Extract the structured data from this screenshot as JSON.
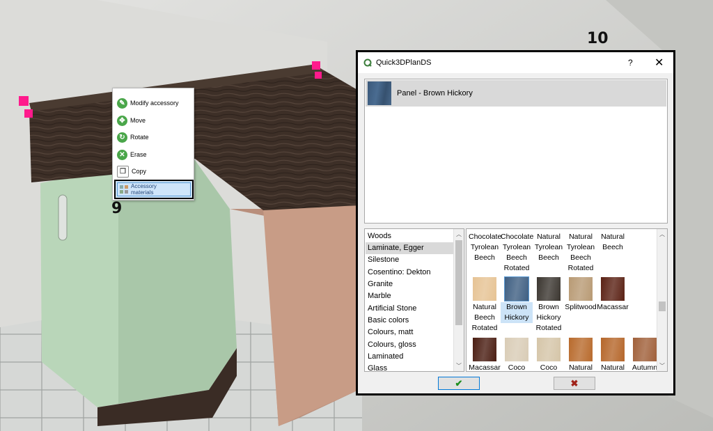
{
  "markers": {
    "step9": "9",
    "step10": "10"
  },
  "context_menu": {
    "items": [
      {
        "label": "Modify accessory",
        "icon": "wrench-icon",
        "color": "#4aa64a"
      },
      {
        "label": "Move",
        "icon": "move-icon",
        "color": "#4aa64a"
      },
      {
        "label": "Rotate",
        "icon": "rotate-icon",
        "color": "#4aa64a"
      },
      {
        "label": "Erase",
        "icon": "trash-icon",
        "color": "#4aa64a"
      },
      {
        "label": "Copy",
        "icon": "copy-icon",
        "color": "#666666"
      }
    ],
    "selected": {
      "line1": "Accessory",
      "line2": "materials",
      "icon": "materials-icon"
    }
  },
  "dialog": {
    "title": "Quick3DPlanDS",
    "help_label": "?",
    "close_label": "✕",
    "current_material": {
      "label": "Panel - Brown Hickory",
      "color": "#3f5f82"
    },
    "categories": [
      "Woods",
      "Laminate, Egger",
      "Silestone",
      "Cosentino: Dekton",
      "Granite",
      "Marble",
      "Artificial Stone",
      "Basic colors",
      "Colours, matt",
      "Colours, gloss",
      "Laminated",
      "Glass"
    ],
    "selected_category": "Laminate, Egger",
    "materials_row1": [
      {
        "lines": [
          "Chocolate",
          "Tyrolean",
          "Beech"
        ]
      },
      {
        "lines": [
          "Chocolate",
          "Tyrolean",
          "Beech",
          "Rotated"
        ]
      },
      {
        "lines": [
          "Natural",
          "Tyrolean",
          "Beech"
        ]
      },
      {
        "lines": [
          "Natural",
          "Tyrolean",
          "Beech",
          "Rotated"
        ]
      },
      {
        "lines": [
          "Natural",
          "Beech"
        ]
      }
    ],
    "materials_row2": [
      {
        "lines": [
          "Natural",
          "Beech",
          "Rotated"
        ],
        "color": "#e6c394"
      },
      {
        "lines": [
          "Brown",
          "Hickory"
        ],
        "color": "#3f5f82",
        "selected": true
      },
      {
        "lines": [
          "Brown",
          "Hickory",
          "Rotated"
        ],
        "color": "#3b3630"
      },
      {
        "lines": [
          "Splitwood"
        ],
        "color": "#b89a74"
      },
      {
        "lines": [
          "Macassar"
        ],
        "color": "#5a2114"
      }
    ],
    "materials_row3": [
      {
        "lines": [
          "Macassar"
        ],
        "color": "#4a1d12"
      },
      {
        "lines": [
          "Coco"
        ],
        "color": "#d9ccb6"
      },
      {
        "lines": [
          "Coco"
        ],
        "color": "#d5c5a8"
      },
      {
        "lines": [
          "Natural"
        ],
        "color": "#b86a2c"
      },
      {
        "lines": [
          "Natural"
        ],
        "color": "#b5662a"
      },
      {
        "lines": [
          "Autumn"
        ],
        "color": "#a0603a"
      }
    ],
    "ok_label": "✔",
    "cancel_label": "✖"
  }
}
